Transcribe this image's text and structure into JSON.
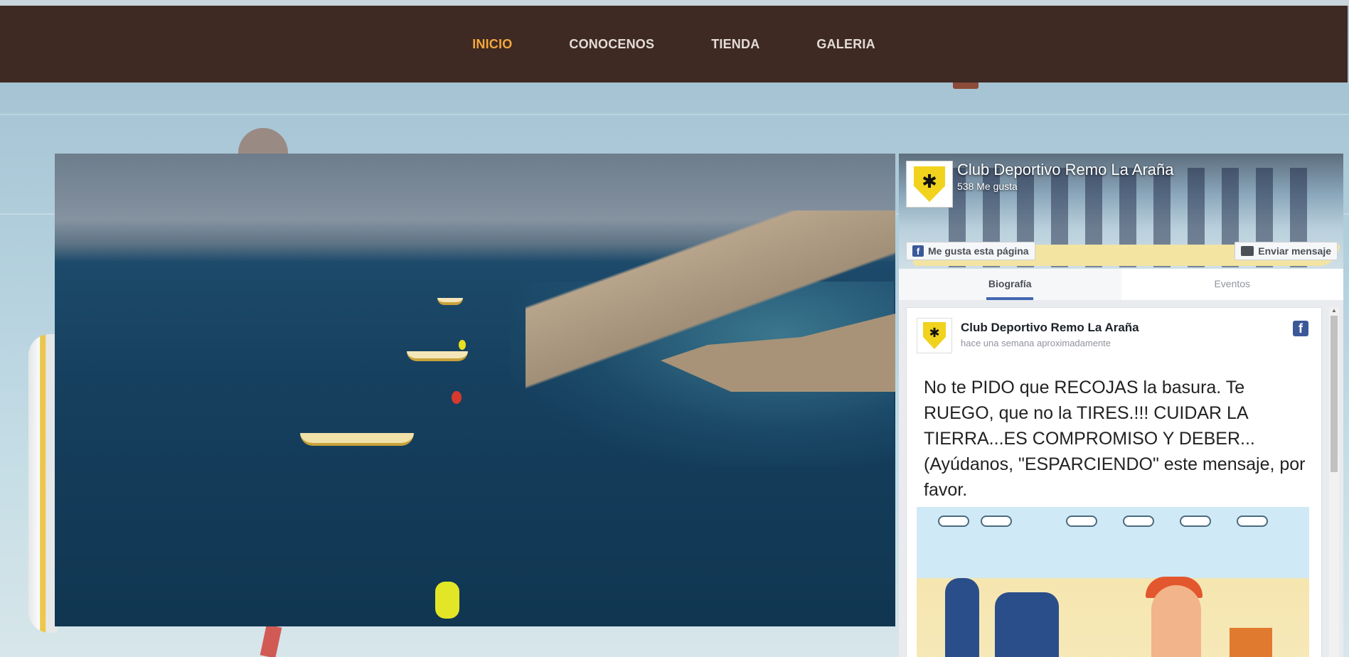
{
  "nav": {
    "items": [
      {
        "label": "INICIO",
        "active": true
      },
      {
        "label": "CONOCENOS",
        "active": false
      },
      {
        "label": "TIENDA",
        "active": false
      },
      {
        "label": "GALERIA",
        "active": false
      }
    ]
  },
  "colors": {
    "nav_bg": "#3e2923",
    "nav_active": "#f3a83c",
    "nav_text": "#e4dcd6",
    "facebook_blue": "#3b5998"
  },
  "hero": {
    "image": "aerial-sea-rowing-race-photo"
  },
  "fb_widget": {
    "page_name": "Club Deportivo Remo La Araña",
    "likes": "538 Me gusta",
    "like_button": "Me gusta esta página",
    "message_button": "Enviar mensaje",
    "tabs": [
      {
        "label": "Biografía",
        "active": true
      },
      {
        "label": "Eventos",
        "active": false
      }
    ],
    "post": {
      "author": "Club Deportivo Remo La Araña",
      "time": "hace una semana aproximadamente",
      "image_text": "No te PIDO que RECOJAS la basura. Te RUEGO, que no la TIRES.!!! CUIDAR LA TIERRA...ES COMPROMISO Y DEBER...(Ayúdanos, \"ESPARCIENDO\"  este mensaje, por favor."
    }
  }
}
